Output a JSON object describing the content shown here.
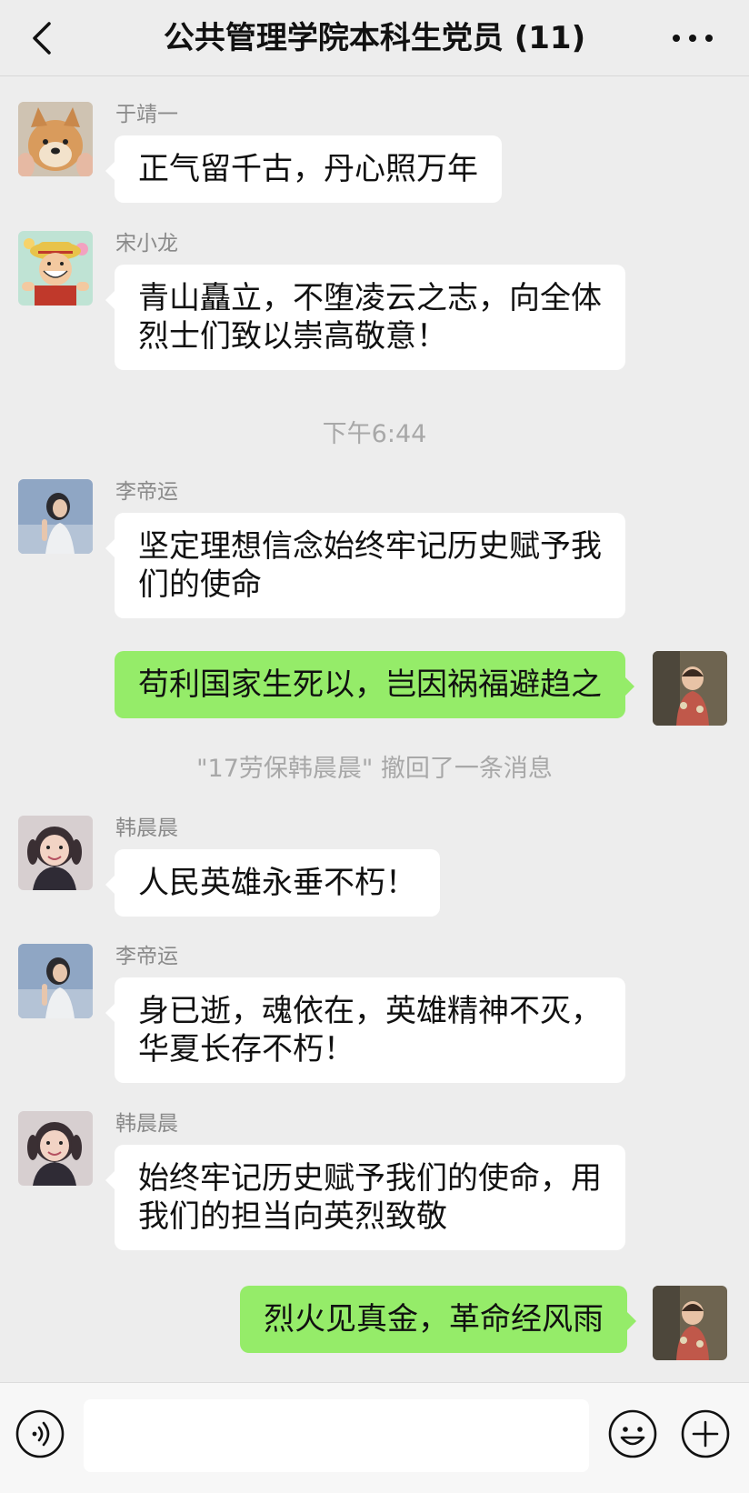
{
  "header": {
    "title": "公共管理学院本科生党员 (11)",
    "back_icon": "chevron-left-icon",
    "more_icon": "more-dots-icon"
  },
  "messages": [
    {
      "side": "left",
      "sender": "于靖一",
      "text": [
        "正气留千古，丹心照万年"
      ],
      "avatar": "shiba-dog-avatar"
    },
    {
      "side": "left",
      "sender": "宋小龙",
      "text": [
        "青山矗立，不堕凌云之志，向全体",
        "烈士们致以崇高敬意！"
      ],
      "avatar": "cartoon-boy-avatar"
    },
    {
      "side": "left",
      "sender": "李帝运",
      "text": [
        "坚定理想信念始终牢记历史赋予我",
        "们的使命"
      ],
      "avatar": "woman-portrait-avatar"
    },
    {
      "side": "right",
      "text": [
        "苟利国家生死以，岂因祸福避趋之"
      ],
      "avatar": "child-photo-avatar"
    },
    {
      "side": "left",
      "sender": "韩晨晨",
      "text": [
        "人民英雄永垂不朽！"
      ],
      "avatar": "little-girl-avatar"
    },
    {
      "side": "left",
      "sender": "李帝运",
      "text": [
        "身已逝，魂依在，英雄精神不灭，",
        "华夏长存不朽！"
      ],
      "avatar": "woman-portrait-avatar"
    },
    {
      "side": "left",
      "sender": "韩晨晨",
      "text": [
        "始终牢记历史赋予我们的使命，用",
        "我们的担当向英烈致敬"
      ],
      "avatar": "little-girl-avatar"
    },
    {
      "side": "right",
      "text": [
        "烈火见真金，革命经风雨"
      ],
      "avatar": "child-photo-avatar"
    }
  ],
  "system": {
    "timestamp": "下午6:44",
    "recall_notice": "\"17劳保韩晨晨\" 撤回了一条消息"
  },
  "input_bar": {
    "voice_icon": "voice-icon",
    "emoji_icon": "emoji-icon",
    "plus_icon": "plus-icon",
    "input_value": ""
  },
  "colors": {
    "background": "#ededed",
    "self_bubble": "#95ec69",
    "other_bubble": "#ffffff",
    "meta_text": "#a8a8a8"
  }
}
